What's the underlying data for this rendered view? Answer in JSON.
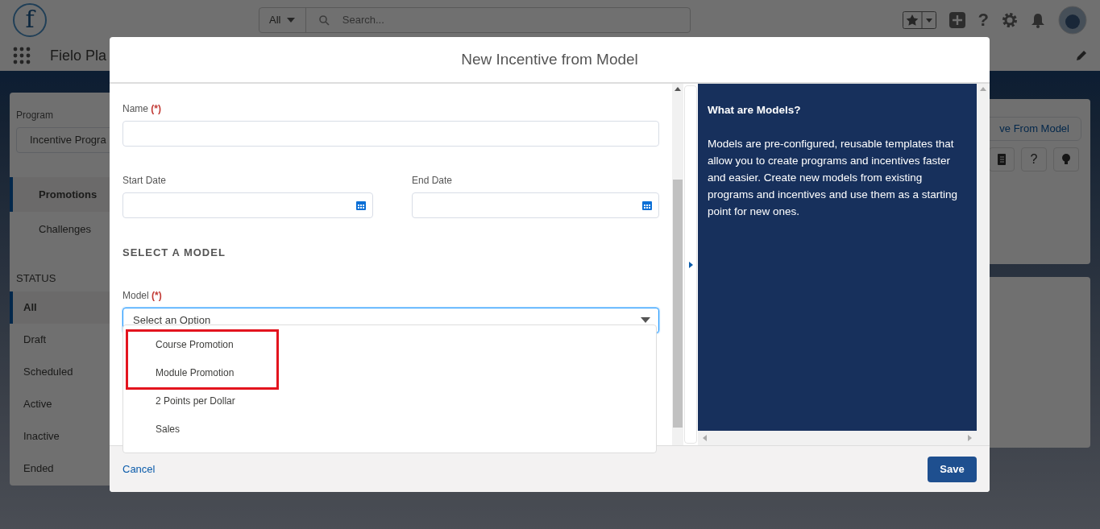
{
  "header": {
    "logo_glyph": "f",
    "help_glyph": "?",
    "search_scope": "All",
    "search_placeholder": "Search..."
  },
  "nav": {
    "app_name": "Fielo Pla"
  },
  "sidebar": {
    "program_label": "Program",
    "program_value": "Incentive Progra",
    "tabs": [
      {
        "label": "Promotions",
        "selected": true
      },
      {
        "label": "Challenges",
        "selected": false
      }
    ],
    "status_heading": "STATUS",
    "statuses": [
      {
        "label": "All",
        "selected": true
      },
      {
        "label": "Draft",
        "selected": false
      },
      {
        "label": "Scheduled",
        "selected": false
      },
      {
        "label": "Active",
        "selected": false
      },
      {
        "label": "Inactive",
        "selected": false
      },
      {
        "label": "Ended",
        "selected": false
      }
    ]
  },
  "toolbar": {
    "button": "ve From Model",
    "help_glyph": "?"
  },
  "modal": {
    "title": "New Incentive from Model",
    "name_field": {
      "label": "Name",
      "required_mark": "(*)"
    },
    "date_fields": [
      {
        "label": "Start Date"
      },
      {
        "label": "End Date"
      }
    ],
    "section_heading": "SELECT A MODEL",
    "model_field": {
      "label": "Model",
      "required_mark": "(*)",
      "value": "Select an Option",
      "options": [
        {
          "label": "Course Promotion",
          "highlighted": true
        },
        {
          "label": "Module Promotion",
          "highlighted": true
        },
        {
          "label": "2 Points per Dollar",
          "highlighted": false
        },
        {
          "label": "Sales",
          "highlighted": false
        }
      ]
    },
    "help": {
      "title": "What are Models?",
      "body": "Models are pre-configured, reusable templates that allow you to create programs and incentives faster and easier. Create new models from existing programs and incentives and use them as a starting point for new ones."
    },
    "cancel": "Cancel",
    "save": "Save"
  }
}
